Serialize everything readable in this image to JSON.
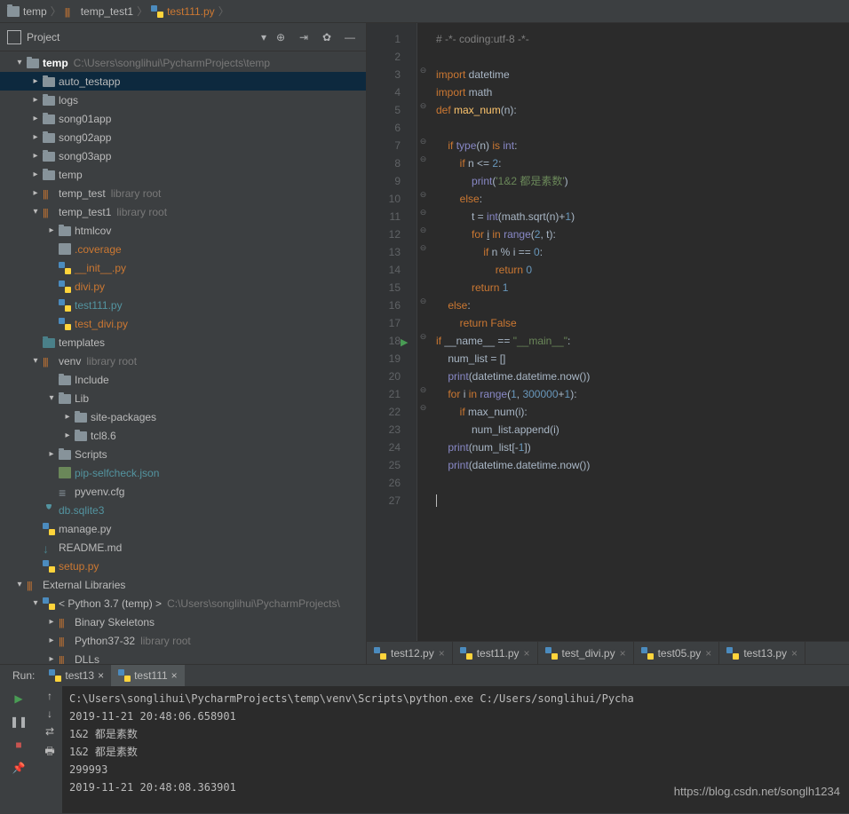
{
  "breadcrumb": {
    "items": [
      {
        "icon": "folder",
        "label": "temp"
      },
      {
        "icon": "folder-lib",
        "label": "temp_test1"
      },
      {
        "icon": "py",
        "label": "test111.py"
      }
    ]
  },
  "project": {
    "title": "Project"
  },
  "tree": [
    {
      "depth": 0,
      "arrow": "down",
      "icon": "folder",
      "name": "temp",
      "meta": "C:\\Users\\songlihui\\PycharmProjects\\temp",
      "bold": true
    },
    {
      "depth": 1,
      "arrow": "right",
      "icon": "folder",
      "name": "auto_testapp",
      "selected": true
    },
    {
      "depth": 1,
      "arrow": "right",
      "icon": "folder",
      "name": "logs"
    },
    {
      "depth": 1,
      "arrow": "right",
      "icon": "folder",
      "name": "song01app"
    },
    {
      "depth": 1,
      "arrow": "right",
      "icon": "folder",
      "name": "song02app"
    },
    {
      "depth": 1,
      "arrow": "right",
      "icon": "folder",
      "name": "song03app"
    },
    {
      "depth": 1,
      "arrow": "right",
      "icon": "folder",
      "name": "temp"
    },
    {
      "depth": 1,
      "arrow": "right",
      "icon": "folder-lib",
      "name": "temp_test",
      "meta": "library root"
    },
    {
      "depth": 1,
      "arrow": "down",
      "icon": "folder-lib",
      "name": "temp_test1",
      "meta": "library root"
    },
    {
      "depth": 2,
      "arrow": "right",
      "icon": "folder",
      "name": "htmlcov"
    },
    {
      "depth": 2,
      "arrow": "none",
      "icon": "file",
      "name": ".coverage",
      "color": "orange"
    },
    {
      "depth": 2,
      "arrow": "none",
      "icon": "py",
      "name": "__init__.py",
      "color": "orange"
    },
    {
      "depth": 2,
      "arrow": "none",
      "icon": "py",
      "name": "divi.py",
      "color": "orange"
    },
    {
      "depth": 2,
      "arrow": "none",
      "icon": "py",
      "name": "test111.py",
      "color": "teal"
    },
    {
      "depth": 2,
      "arrow": "none",
      "icon": "py",
      "name": "test_divi.py",
      "color": "orange"
    },
    {
      "depth": 1,
      "arrow": "none",
      "icon": "tealfolder",
      "name": "templates"
    },
    {
      "depth": 1,
      "arrow": "down",
      "icon": "folder-lib",
      "name": "venv",
      "meta": "library root"
    },
    {
      "depth": 2,
      "arrow": "none",
      "icon": "folder",
      "name": "Include"
    },
    {
      "depth": 2,
      "arrow": "down",
      "icon": "folder",
      "name": "Lib"
    },
    {
      "depth": 3,
      "arrow": "right",
      "icon": "folder",
      "name": "site-packages"
    },
    {
      "depth": 3,
      "arrow": "right",
      "icon": "folder",
      "name": "tcl8.6"
    },
    {
      "depth": 2,
      "arrow": "right",
      "icon": "folder",
      "name": "Scripts"
    },
    {
      "depth": 2,
      "arrow": "none",
      "icon": "json",
      "name": "pip-selfcheck.json",
      "color": "teal"
    },
    {
      "depth": 2,
      "arrow": "none",
      "icon": "cfg",
      "name": "pyvenv.cfg"
    },
    {
      "depth": 1,
      "arrow": "none",
      "icon": "db",
      "name": "db.sqlite3",
      "color": "teal"
    },
    {
      "depth": 1,
      "arrow": "none",
      "icon": "py",
      "name": "manage.py"
    },
    {
      "depth": 1,
      "arrow": "none",
      "icon": "md",
      "name": "README.md"
    },
    {
      "depth": 1,
      "arrow": "none",
      "icon": "py",
      "name": "setup.py",
      "color": "orange"
    },
    {
      "depth": 0,
      "arrow": "down",
      "icon": "lib",
      "name": "External Libraries"
    },
    {
      "depth": 1,
      "arrow": "down",
      "icon": "py",
      "name": "< Python 3.7 (temp) >",
      "meta": "C:\\Users\\songlihui\\PycharmProjects\\"
    },
    {
      "depth": 2,
      "arrow": "right",
      "icon": "lib",
      "name": "Binary Skeletons"
    },
    {
      "depth": 2,
      "arrow": "right",
      "icon": "folder-lib",
      "name": "Python37-32",
      "meta": "library root"
    },
    {
      "depth": 2,
      "arrow": "right",
      "icon": "folder-lib",
      "name": "DLLs"
    }
  ],
  "code": {
    "lines": [
      {
        "n": 1,
        "html": "<span class='com'># -*- coding:utf-8 -*-</span>"
      },
      {
        "n": 2,
        "html": ""
      },
      {
        "n": 3,
        "html": "<span class='kw'>import</span> datetime"
      },
      {
        "n": 4,
        "html": "<span class='kw'>import</span> math"
      },
      {
        "n": 5,
        "html": "<span class='kw'>def </span><span class='fn'>max_num</span>(n):"
      },
      {
        "n": 6,
        "html": ""
      },
      {
        "n": 7,
        "html": "    <span class='kw'>if</span> <span class='bi'>type</span>(n) <span class='kw'>is</span> <span class='bi'>int</span>:"
      },
      {
        "n": 8,
        "html": "        <span class='kw'>if</span> n &lt;= <span class='num'>2</span>:"
      },
      {
        "n": 9,
        "html": "            <span class='bi'>print</span>(<span class='str'>'1&amp;2 都是素数'</span>)"
      },
      {
        "n": 10,
        "html": "        <span class='kw'>else</span>:"
      },
      {
        "n": 11,
        "html": "            t = <span class='bi'>int</span>(math.sqrt(n)+<span class='num'>1</span>)"
      },
      {
        "n": 12,
        "html": "            <span class='kw'>for</span> <span style='text-decoration:underline'>i</span> <span class='kw'>in</span> <span class='bi'>range</span>(<span class='num'>2</span>, t):"
      },
      {
        "n": 13,
        "html": "                <span class='kw'>if</span> n % i == <span class='num'>0</span>:"
      },
      {
        "n": 14,
        "html": "                    <span class='kw'>return</span> <span class='num'>0</span>"
      },
      {
        "n": 15,
        "html": "            <span class='kw'>return</span> <span class='num'>1</span>"
      },
      {
        "n": 16,
        "html": "    <span class='kw'>else</span>:"
      },
      {
        "n": 17,
        "html": "        <span class='kw'>return</span> <span class='kw'>False</span>"
      },
      {
        "n": 18,
        "html": "<span class='kw'>if</span> __name__ == <span class='str'>\"__main__\"</span>:",
        "play": true
      },
      {
        "n": 19,
        "html": "    num_list = []"
      },
      {
        "n": 20,
        "html": "    <span class='bi'>print</span>(datetime.datetime.now())"
      },
      {
        "n": 21,
        "html": "    <span class='kw'>for</span> i <span class='kw'>in</span> <span class='bi'>range</span>(<span class='num'>1</span>, <span class='num'>300000</span>+<span class='num'>1</span>):"
      },
      {
        "n": 22,
        "html": "        <span class='kw'>if</span> max_num(i):"
      },
      {
        "n": 23,
        "html": "            num_list.append(i)"
      },
      {
        "n": 24,
        "html": "    <span class='bi'>print</span>(num_list[-<span class='num'>1</span>])"
      },
      {
        "n": 25,
        "html": "    <span class='bi'>print</span>(datetime.datetime.now())"
      },
      {
        "n": 26,
        "html": ""
      },
      {
        "n": 27,
        "html": "<span class='cursor'></span>"
      }
    ]
  },
  "editor_tabs": [
    {
      "label": "test12.py"
    },
    {
      "label": "test11.py"
    },
    {
      "label": "test_divi.py"
    },
    {
      "label": "test05.py"
    },
    {
      "label": "test13.py"
    }
  ],
  "run": {
    "label": "Run:",
    "tabs": [
      {
        "label": "test13"
      },
      {
        "label": "test111",
        "active": true
      }
    ],
    "output": "C:\\Users\\songlihui\\PycharmProjects\\temp\\venv\\Scripts\\python.exe C:/Users/songlihui/Pycha\n2019-11-21 20:48:06.658901\n1&2 都是素数\n1&2 都是素数\n299993\n2019-11-21 20:48:08.363901\n"
  },
  "watermark": "https://blog.csdn.net/songlh1234"
}
